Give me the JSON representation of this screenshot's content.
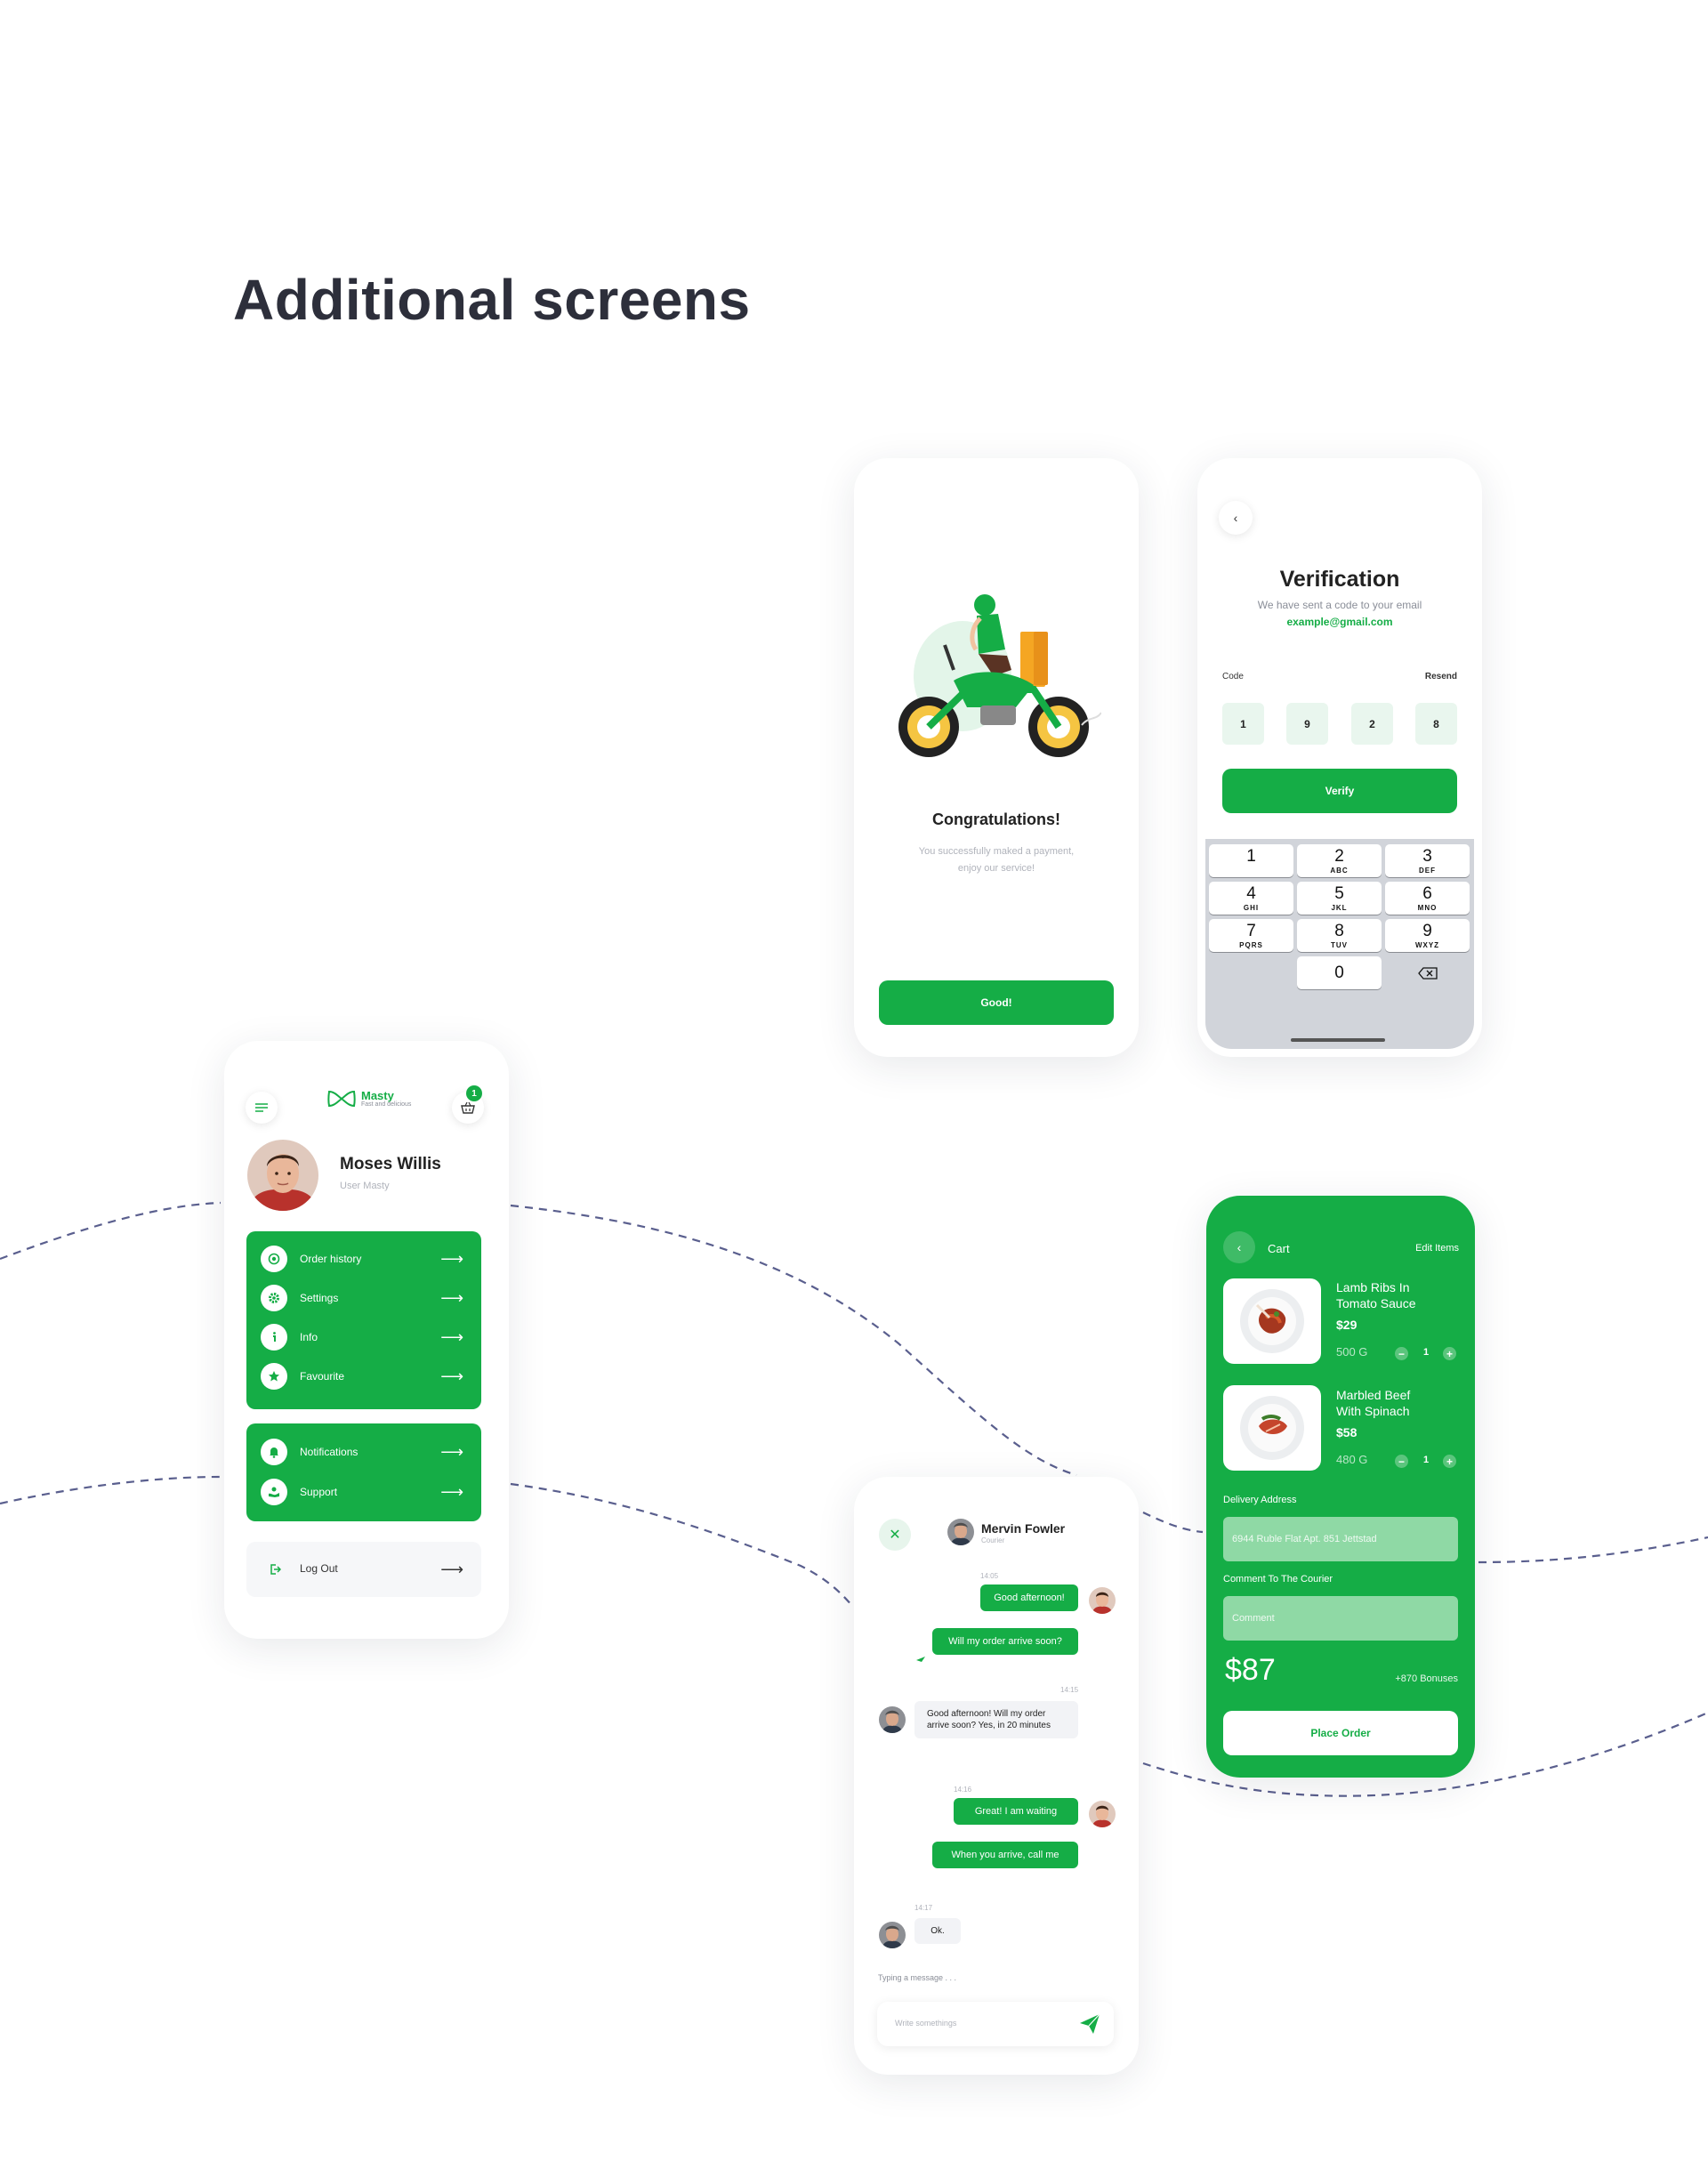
{
  "page": {
    "heading": "Additional screens"
  },
  "colors": {
    "accent": "#15ad46",
    "accent_light": "#8fd9a5",
    "text_dark": "#2d2f3b",
    "muted": "#b0b3bb"
  },
  "congrats": {
    "illustration_icon": "courier-motorcycle-illustration",
    "title": "Congratulations!",
    "text_line1": "You successfully maked a payment,",
    "text_line2": "enjoy our service!",
    "button_label": "Good!"
  },
  "verification": {
    "back_icon": "chevron-left-icon",
    "title": "Verification",
    "subtitle": "We have sent a code to your email",
    "email": "example@gmail.com",
    "code_label": "Code",
    "resend_label": "Resend",
    "code_digits": [
      "1",
      "9",
      "2",
      "8"
    ],
    "verify_label": "Verify",
    "keypad": [
      {
        "num": "1",
        "letters": ""
      },
      {
        "num": "2",
        "letters": "ABC"
      },
      {
        "num": "3",
        "letters": "DEF"
      },
      {
        "num": "4",
        "letters": "GHI"
      },
      {
        "num": "5",
        "letters": "JKL"
      },
      {
        "num": "6",
        "letters": "MNO"
      },
      {
        "num": "7",
        "letters": "PQRS"
      },
      {
        "num": "8",
        "letters": "TUV"
      },
      {
        "num": "9",
        "letters": "WXYZ"
      }
    ],
    "keypad_zero": "0",
    "delete_icon": "backspace-icon"
  },
  "profile": {
    "menu_icon": "hamburger-icon",
    "logo_name": "Masty",
    "logo_tagline": "Fast and delicious",
    "cart_badge": "1",
    "user_name": "Moses Willis",
    "user_role": "User Masty",
    "menu_group1": [
      {
        "label": "Order history",
        "icon": "order-history-icon"
      },
      {
        "label": "Settings",
        "icon": "settings-gear-icon"
      },
      {
        "label": "Info",
        "icon": "info-icon"
      },
      {
        "label": "Favourite",
        "icon": "star-icon"
      }
    ],
    "menu_group2": [
      {
        "label": "Notifications",
        "icon": "bell-icon"
      },
      {
        "label": "Support",
        "icon": "support-icon"
      }
    ],
    "logout_label": "Log Out",
    "arrow_glyph": "⟶"
  },
  "cart": {
    "title": "Cart",
    "edit_label": "Edit Items",
    "items": [
      {
        "name_line1": "Lamb Ribs In",
        "name_line2": "Tomato Sauce",
        "price": "$29",
        "weight": "500 G",
        "qty": "1"
      },
      {
        "name_line1": "Marbled Beef",
        "name_line2": "With Spinach",
        "price": "$58",
        "weight": "480 G",
        "qty": "1"
      }
    ],
    "address_label": "Delivery Address",
    "address_value": "6944 Ruble Flat Apt. 851 Jettstad",
    "comment_label": "Comment To The Courier",
    "comment_placeholder": "Comment",
    "total": "$87",
    "bonus": "+870 Bonuses",
    "place_order_label": "Place Order",
    "minus_glyph": "−",
    "plus_glyph": "+"
  },
  "chat": {
    "close_glyph": "✕",
    "contact_name": "Mervin Fowler",
    "contact_role": "Courier",
    "messages": [
      {
        "time": "14:05",
        "text": "Good afternoon!"
      },
      {
        "text": "Will my order arrive soon?"
      },
      {
        "time": "14:15",
        "text": "Good afternoon! Will my order arrive soon? Yes, in 20 minutes"
      },
      {
        "time": "14:16",
        "text": "Great! I am waiting"
      },
      {
        "text": "When you arrive, call me"
      },
      {
        "time": "14:17",
        "text": "Ok."
      }
    ],
    "typing_label": "Typing a message . . .",
    "input_placeholder": "Write somethings",
    "send_icon": "send-paper-plane-icon"
  }
}
